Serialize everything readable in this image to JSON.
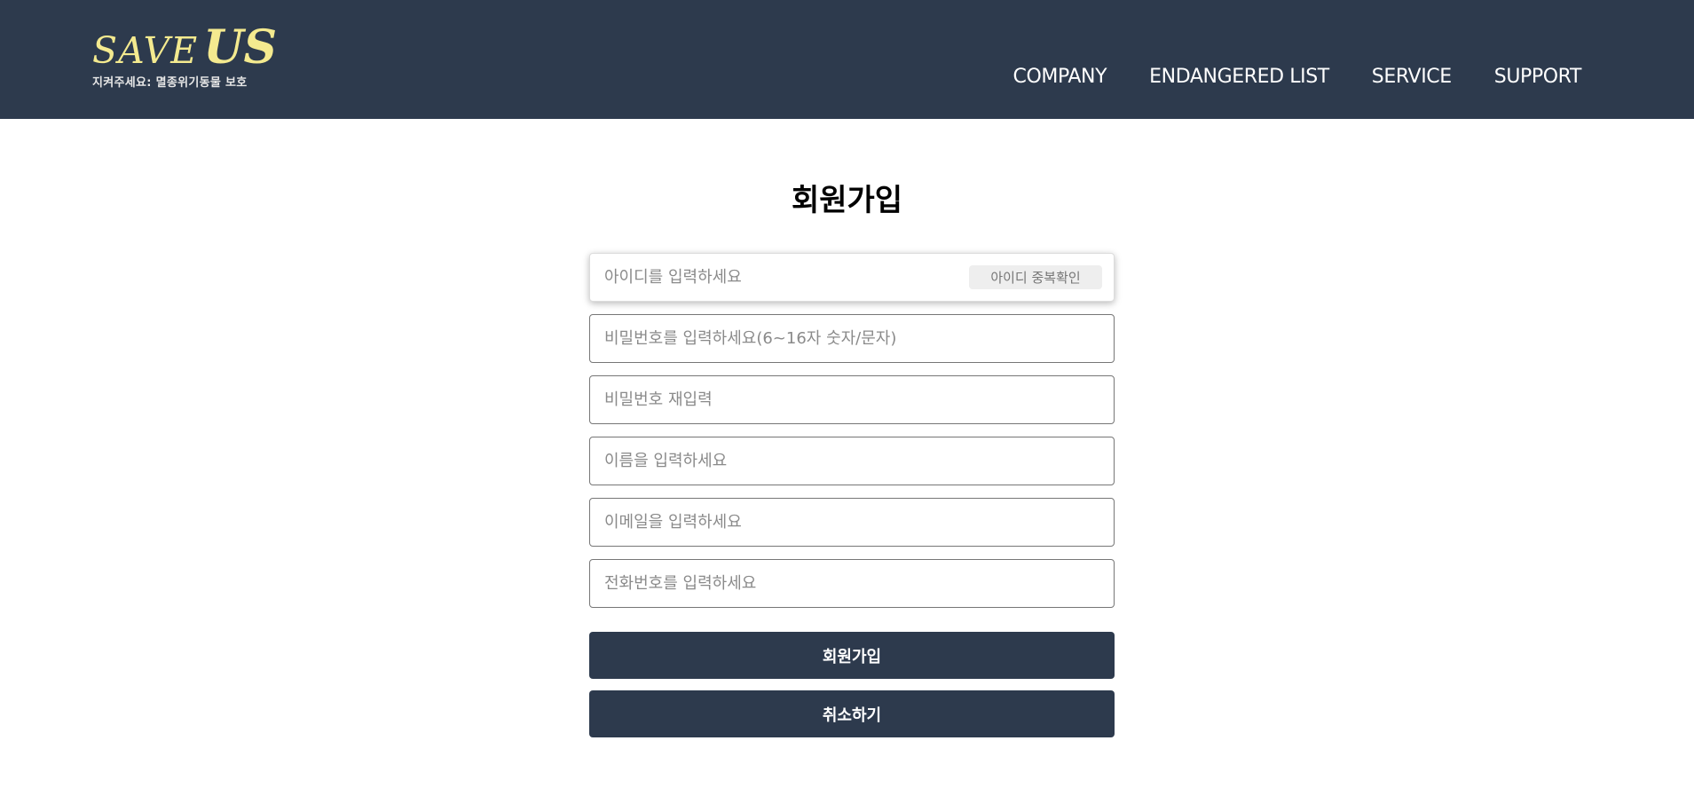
{
  "header": {
    "logo_save": "SAVE",
    "logo_us": "US",
    "logo_subtitle": "지켜주세요: 멸종위기동물 보호",
    "nav": [
      {
        "label": "COMPANY"
      },
      {
        "label": "ENDANGERED LIST"
      },
      {
        "label": "SERVICE"
      },
      {
        "label": "SUPPORT"
      }
    ]
  },
  "main": {
    "title": "회원가입",
    "fields": {
      "id_placeholder": "아이디를 입력하세요",
      "id_check_label": "아이디 중복확인",
      "password_placeholder": "비밀번호를 입력하세요(6~16자 숫자/문자)",
      "password_confirm_placeholder": "비밀번호 재입력",
      "name_placeholder": "이름을 입력하세요",
      "email_placeholder": "이메일을 입력하세요",
      "phone_placeholder": "전화번호를 입력하세요"
    },
    "signup_label": "회원가입",
    "cancel_label": "취소하기"
  },
  "colors": {
    "header_bg": "#2d3a4d",
    "logo_yellow": "#f4ea8f",
    "button_bg": "#2d3a4d"
  }
}
